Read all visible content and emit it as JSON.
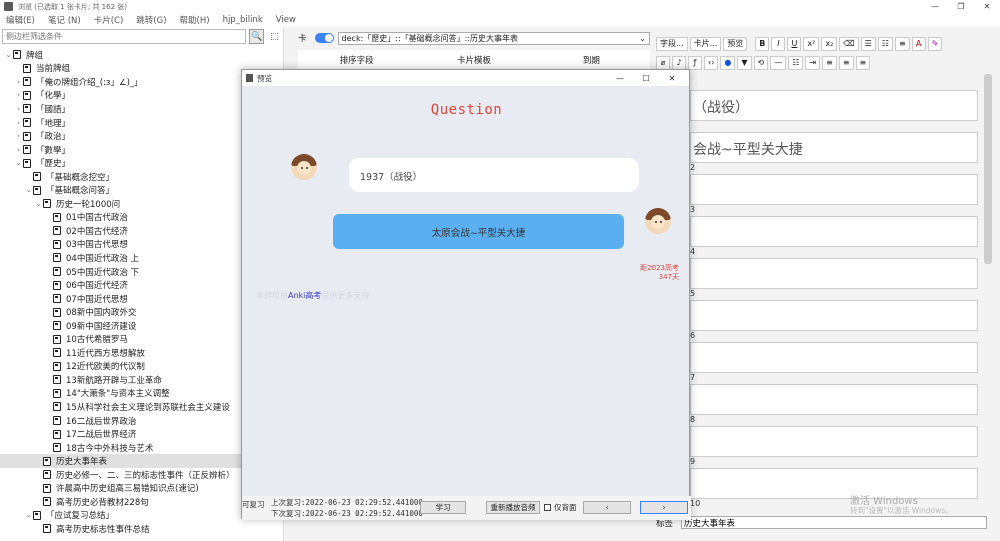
{
  "window": {
    "title": "浏览 (已选取 1 张卡片; 共 162 张)",
    "controls": [
      "—",
      "❐",
      "✕"
    ]
  },
  "menu": [
    "编辑(E)",
    "笔记 (N)",
    "卡片(C)",
    "跳转(G)",
    "帮助(H)",
    "hjp_bilink",
    "View"
  ],
  "sidebar": {
    "search_placeholder": "侧边栏筛选条件",
    "search_icon": "search-icon",
    "tree": [
      {
        "label": "牌组",
        "indent": 0,
        "arrow": "⌄"
      },
      {
        "label": "当前牌组",
        "indent": 1,
        "arrow": ""
      },
      {
        "label": "「俺の牌组介绍_(:з」∠)_」",
        "indent": 1,
        "arrow": "›"
      },
      {
        "label": "「化學」",
        "indent": 1,
        "arrow": "›"
      },
      {
        "label": "「國語」",
        "indent": 1,
        "arrow": "›"
      },
      {
        "label": "「地理」",
        "indent": 1,
        "arrow": "›"
      },
      {
        "label": "「政治」",
        "indent": 1,
        "arrow": "›"
      },
      {
        "label": "「數學」",
        "indent": 1,
        "arrow": "›"
      },
      {
        "label": "「歷史」",
        "indent": 1,
        "arrow": "⌄"
      },
      {
        "label": "「基础概念挖空」",
        "indent": 2,
        "arrow": ""
      },
      {
        "label": "「基础概念问答」",
        "indent": 2,
        "arrow": "⌄"
      },
      {
        "label": "历史一轮1000问",
        "indent": 3,
        "arrow": "⌄"
      },
      {
        "label": "01中国古代政治",
        "indent": 4,
        "arrow": ""
      },
      {
        "label": "02中国古代经济",
        "indent": 4,
        "arrow": ""
      },
      {
        "label": "03中国古代思想",
        "indent": 4,
        "arrow": ""
      },
      {
        "label": "04中国近代政治 上",
        "indent": 4,
        "arrow": ""
      },
      {
        "label": "05中国近代政治 下",
        "indent": 4,
        "arrow": ""
      },
      {
        "label": "06中国近代经济",
        "indent": 4,
        "arrow": ""
      },
      {
        "label": "07中国近代思想",
        "indent": 4,
        "arrow": ""
      },
      {
        "label": "08新中国内政外交",
        "indent": 4,
        "arrow": ""
      },
      {
        "label": "09新中国经济建设",
        "indent": 4,
        "arrow": ""
      },
      {
        "label": "10古代希腊罗马",
        "indent": 4,
        "arrow": ""
      },
      {
        "label": "11近代西方思想解放",
        "indent": 4,
        "arrow": ""
      },
      {
        "label": "12近代欧美的代议制",
        "indent": 4,
        "arrow": ""
      },
      {
        "label": "13新航路开辟与工业革命",
        "indent": 4,
        "arrow": ""
      },
      {
        "label": "14\"大萧条\"与资本主义调整",
        "indent": 4,
        "arrow": ""
      },
      {
        "label": "15从科学社会主义理论到苏联社会主义建设",
        "indent": 4,
        "arrow": ""
      },
      {
        "label": "16二战后世界政治",
        "indent": 4,
        "arrow": ""
      },
      {
        "label": "17二战后世界经济",
        "indent": 4,
        "arrow": ""
      },
      {
        "label": "18古今中外科技与艺术",
        "indent": 4,
        "arrow": ""
      },
      {
        "label": "历史大事年表",
        "indent": 3,
        "arrow": "",
        "selected": true
      },
      {
        "label": "历史必修一、二、三的标志性事件（正反辨析）",
        "indent": 3,
        "arrow": ""
      },
      {
        "label": "许晨高中历史组高三易错知识点(速记)",
        "indent": 3,
        "arrow": ""
      },
      {
        "label": "高考历史必背教材228句",
        "indent": 3,
        "arrow": ""
      },
      {
        "label": "「应试复习总结」",
        "indent": 2,
        "arrow": "⌄"
      },
      {
        "label": "高考历史标志性事件总结",
        "indent": 3,
        "arrow": ""
      }
    ]
  },
  "browser": {
    "mode_label": "卡",
    "deck_query": "deck:「歷史」::「基础概念问答」::历史大事年表",
    "columns": [
      "排序字段",
      "卡片模板",
      "到期"
    ]
  },
  "editor": {
    "toolbar_buttons": [
      "字段...",
      "卡片...",
      "预览"
    ],
    "format_buttons": [
      "B",
      "I",
      "U",
      "x²",
      "x₂",
      "⌫",
      "☰",
      "☷",
      "≡"
    ],
    "field_numbers": [
      "2",
      "3",
      "4",
      "5",
      "6",
      "7",
      "8",
      "9",
      "10"
    ],
    "field_1_text": "（战役）",
    "field_2_text": "会战~平型关大捷",
    "tags_label": "标签",
    "tags_value": "历史大事年表"
  },
  "preview": {
    "title": "预览",
    "question_header": "Question",
    "question_text": "1937（战役）",
    "answer_text": "太原会战~平型关大捷",
    "countdown_line1": "距2023高考",
    "countdown_line2": "347天",
    "promo_prefix": "本牌组由",
    "promo_highlight": "Anki高考",
    "promo_suffix": "提供更多支持",
    "left_label": "可复习",
    "prev_review": "上次复习:2022-06-23 02:29:52.441000",
    "next_review": "下次复习:2022-06-23 02:29:52.441000",
    "btn_study": "学习",
    "btn_replay": "重新播放音频",
    "chk_back_only": "仅背面",
    "btn_prev": "‹",
    "btn_next": "›"
  },
  "watermark": {
    "line1": "激活 Windows",
    "line2": "转到\"设置\"以激活 Windows。"
  },
  "colors": {
    "accent": "#3b82f6",
    "answer_bubble": "#5aaff1",
    "question_header": "#e0463c"
  }
}
